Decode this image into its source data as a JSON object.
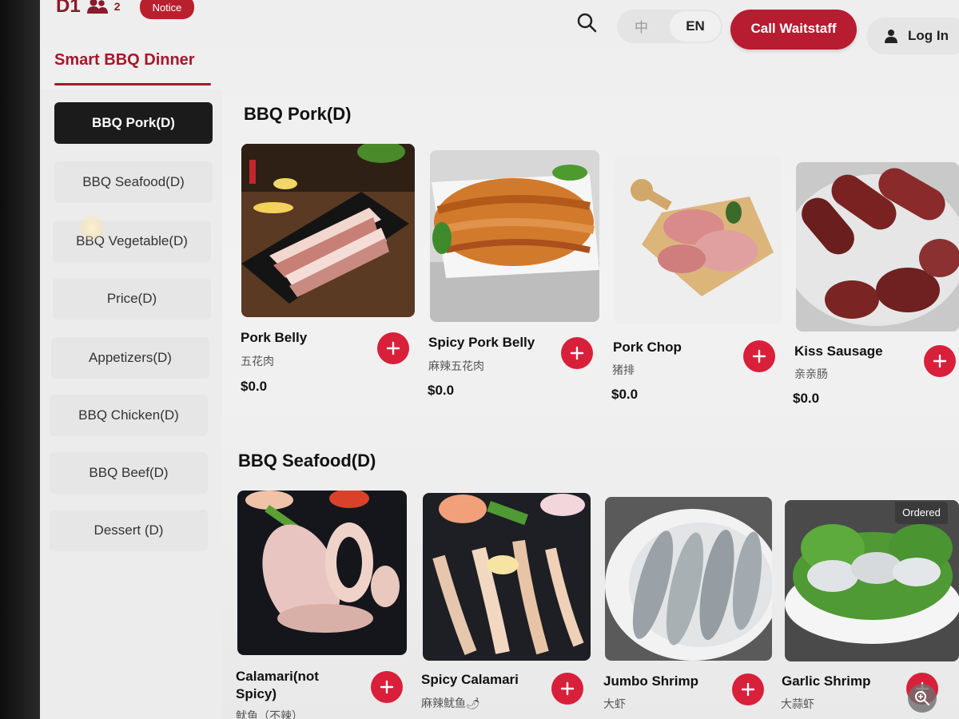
{
  "header": {
    "table_id": "D1",
    "guest_count": "2",
    "notice_label": "Notice",
    "app_title": "Smart BBQ Dinner",
    "lang_zh": "中",
    "lang_en": "EN",
    "call_label": "Call Waitstaff",
    "login_label": "Log In"
  },
  "colors": {
    "accent": "#b71c30",
    "add_button": "#d8203a",
    "active_category": "#1b1b1b"
  },
  "sidebar": {
    "items": [
      {
        "label": "BBQ Pork(D)",
        "active": true
      },
      {
        "label": "BBQ Seafood(D)"
      },
      {
        "label": "BBQ Vegetable(D)"
      },
      {
        "label": "Price(D)"
      },
      {
        "label": "Appetizers(D)"
      },
      {
        "label": "BBQ Chicken(D)"
      },
      {
        "label": "BBQ Beef(D)"
      },
      {
        "label": "Dessert (D)"
      }
    ]
  },
  "sections": [
    {
      "title": "BBQ Pork(D)",
      "items": [
        {
          "name": "Pork Belly",
          "cn": "五花肉",
          "price": "$0.0"
        },
        {
          "name": "Spicy Pork Belly",
          "cn": "麻辣五花肉",
          "price": "$0.0"
        },
        {
          "name": "Pork Chop",
          "cn": "猪排",
          "price": "$0.0"
        },
        {
          "name": "Kiss Sausage",
          "cn": "亲亲肠",
          "price": "$0.0"
        }
      ]
    },
    {
      "title": "BBQ Seafood(D)",
      "items": [
        {
          "name": "Calamari(not Spicy)",
          "cn": "鱿鱼（不辣）"
        },
        {
          "name": "Spicy Calamari",
          "cn": "麻辣鱿鱼🌶"
        },
        {
          "name": "Jumbo Shrimp",
          "cn": "大虾"
        },
        {
          "name": "Garlic Shrimp",
          "cn": "大蒜虾",
          "badge": "Ordered"
        }
      ]
    }
  ],
  "icons": [
    "user-group-icon",
    "search-icon",
    "person-icon",
    "plus-icon",
    "zoom-icon"
  ]
}
